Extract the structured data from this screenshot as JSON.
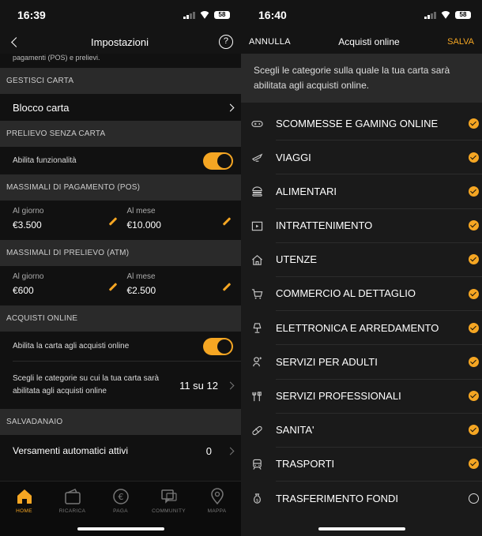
{
  "left": {
    "status": {
      "time": "16:39",
      "battery": "58"
    },
    "header": {
      "title": "Impostazioni",
      "help": "?"
    },
    "cut_text": "pagamenti (POS) e prelievi.",
    "sections": {
      "gestisci": "GESTISCI CARTA",
      "prelievo_senza": "PRELIEVO SENZA CARTA",
      "max_pos": "MASSIMALI DI PAGAMENTO (POS)",
      "max_atm": "MASSIMALI DI PRELIEVO (ATM)",
      "acquisti": "ACQUISTI ONLINE",
      "salvadanaio": "SALVADANAIO"
    },
    "blocco_carta": "Blocco carta",
    "abilita_funz": "Abilita funzionalità",
    "pos": {
      "day_label": "Al giorno",
      "day_value": "€3.500",
      "month_label": "Al mese",
      "month_value": "€10.000"
    },
    "atm": {
      "day_label": "Al giorno",
      "day_value": "€600",
      "month_label": "Al mese",
      "month_value": "€2.500"
    },
    "abilita_online": "Abilita la carta agli acquisti online",
    "categorie_text": "Scegli le categorie su cui la tua carta sarà abilitata agli acquisti online",
    "categorie_count": "11 su 12",
    "versamenti": "Versamenti automatici attivi",
    "versamenti_count": "0",
    "tabs": [
      {
        "label": "HOME",
        "icon": "home-icon"
      },
      {
        "label": "RICARICA",
        "icon": "wallet-icon"
      },
      {
        "label": "PAGA",
        "icon": "euro-icon"
      },
      {
        "label": "COMMUNITY",
        "icon": "chat-icon"
      },
      {
        "label": "MAPPA",
        "icon": "map-pin-icon"
      }
    ]
  },
  "right": {
    "status": {
      "time": "16:40",
      "battery": "58"
    },
    "header": {
      "cancel": "ANNULLA",
      "title": "Acquisti online",
      "save": "SALVA"
    },
    "intro": "Scegli le categorie sulla quale la tua carta sarà abilitata agli acquisti online.",
    "categories": [
      {
        "label": "SCOMMESSE E GAMING ONLINE",
        "icon": "gamepad-icon",
        "checked": true
      },
      {
        "label": "VIAGGI",
        "icon": "plane-icon",
        "checked": true
      },
      {
        "label": "ALIMENTARI",
        "icon": "burger-icon",
        "checked": true
      },
      {
        "label": "INTRATTENIMENTO",
        "icon": "film-icon",
        "checked": true
      },
      {
        "label": "UTENZE",
        "icon": "house-icon",
        "checked": true
      },
      {
        "label": "COMMERCIO AL DETTAGLIO",
        "icon": "cart-icon",
        "checked": true
      },
      {
        "label": "ELETTRONICA E ARREDAMENTO",
        "icon": "lamp-icon",
        "checked": true
      },
      {
        "label": "SERVIZI PER ADULTI",
        "icon": "adult-icon",
        "checked": true
      },
      {
        "label": "SERVIZI PROFESSIONALI",
        "icon": "tools-icon",
        "checked": true
      },
      {
        "label": "SANITA'",
        "icon": "pill-icon",
        "checked": true
      },
      {
        "label": "TRASPORTI",
        "icon": "train-icon",
        "checked": true
      },
      {
        "label": "TRASFERIMENTO FONDI",
        "icon": "money-bag-icon",
        "checked": false
      }
    ]
  },
  "colors": {
    "accent": "#f5a623",
    "section_bg": "#2a2a2a",
    "bg": "#111111"
  }
}
